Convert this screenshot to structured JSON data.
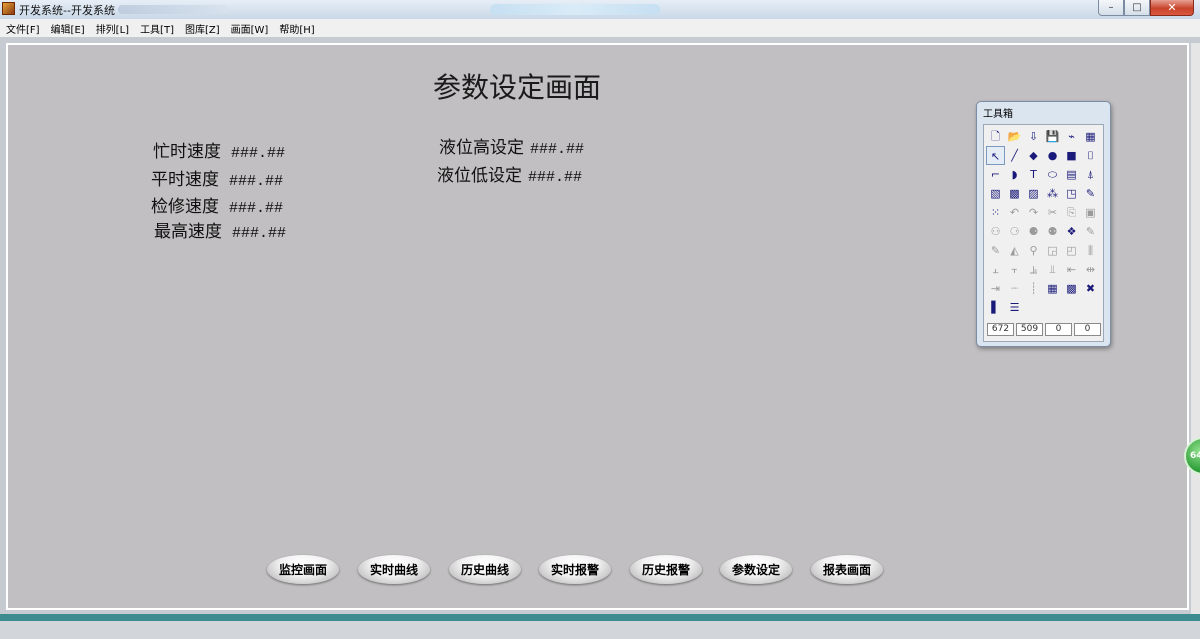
{
  "window": {
    "title": "开发系统--开发系统",
    "buttons": {
      "minimize": "–",
      "maximize": "□",
      "close": "✕"
    }
  },
  "menu": [
    "文件[F]",
    "编辑[E]",
    "排列[L]",
    "工具[T]",
    "图库[Z]",
    "画面[W]",
    "帮助[H]"
  ],
  "screen": {
    "title": "参数设定画面",
    "params_left": [
      {
        "label": "忙时速度",
        "value": "###.##"
      },
      {
        "label": "平时速度",
        "value": "###.##"
      },
      {
        "label": "检修速度",
        "value": "###.##"
      },
      {
        "label": "最高速度",
        "value": "###.##"
      }
    ],
    "params_right": [
      {
        "label": "液位高设定",
        "value": "###.##"
      },
      {
        "label": "液位低设定",
        "value": "###.##"
      }
    ],
    "nav_buttons": [
      "监控画面",
      "实时曲线",
      "历史曲线",
      "实时报警",
      "历史报警",
      "参数设定",
      "报表画面"
    ]
  },
  "toolbox": {
    "title": "工具箱",
    "tools": [
      {
        "glyph": "🗋",
        "name": "new-icon"
      },
      {
        "glyph": "📂",
        "name": "open-icon"
      },
      {
        "glyph": "⇩",
        "name": "import-icon"
      },
      {
        "glyph": "💾",
        "name": "save-icon",
        "dim": true
      },
      {
        "glyph": "⌁",
        "name": "chart-icon"
      },
      {
        "glyph": "▦",
        "name": "picture-icon"
      },
      {
        "glyph": "↖",
        "name": "pointer-icon",
        "sel": true
      },
      {
        "glyph": "╱",
        "name": "line-icon"
      },
      {
        "glyph": "◆",
        "name": "polygon-icon"
      },
      {
        "glyph": "●",
        "name": "ellipse-icon"
      },
      {
        "glyph": "■",
        "name": "rectangle-icon"
      },
      {
        "glyph": "⌷",
        "name": "pipe-icon"
      },
      {
        "glyph": "⌐",
        "name": "polyline-icon"
      },
      {
        "glyph": "◗",
        "name": "arc-icon"
      },
      {
        "glyph": "T",
        "name": "text-icon"
      },
      {
        "glyph": "⬭",
        "name": "rounded-rect-icon"
      },
      {
        "glyph": "▤",
        "name": "button-icon"
      },
      {
        "glyph": "⍋",
        "name": "symbol-icon"
      },
      {
        "glyph": "▧",
        "name": "trend-icon"
      },
      {
        "glyph": "▩",
        "name": "alarm-window-icon"
      },
      {
        "glyph": "▨",
        "name": "report-icon"
      },
      {
        "glyph": "⁂",
        "name": "control-icon"
      },
      {
        "glyph": "◳",
        "name": "gauge-icon"
      },
      {
        "glyph": "✎",
        "name": "edit-icon"
      },
      {
        "glyph": "⁙",
        "name": "menu-icon"
      },
      {
        "glyph": "↶",
        "name": "undo-icon",
        "dim": true
      },
      {
        "glyph": "↷",
        "name": "redo-icon",
        "dim": true
      },
      {
        "glyph": "✂",
        "name": "cut-icon",
        "dim": true
      },
      {
        "glyph": "⎘",
        "name": "copy-icon",
        "dim": true
      },
      {
        "glyph": "▣",
        "name": "paste-icon",
        "dim": true
      },
      {
        "glyph": "⚇",
        "name": "group-icon",
        "dim": true
      },
      {
        "glyph": "⚆",
        "name": "ungroup-icon",
        "dim": true
      },
      {
        "glyph": "⚈",
        "name": "combine-icon",
        "dim": true
      },
      {
        "glyph": "⚉",
        "name": "split-icon",
        "dim": true
      },
      {
        "glyph": "❖",
        "name": "merge-icon"
      },
      {
        "glyph": "✎",
        "name": "reshape-icon",
        "dim": true
      },
      {
        "glyph": "✎",
        "name": "rotate-icon",
        "dim": true
      },
      {
        "glyph": "◭",
        "name": "flip-icon",
        "dim": true
      },
      {
        "glyph": "⚲",
        "name": "mirror-icon",
        "dim": true
      },
      {
        "glyph": "◲",
        "name": "front-icon",
        "dim": true
      },
      {
        "glyph": "◰",
        "name": "back-icon",
        "dim": true
      },
      {
        "glyph": "⫼",
        "name": "align-left-icon",
        "dim": true
      },
      {
        "glyph": "⫠",
        "name": "align-top-icon",
        "dim": true
      },
      {
        "glyph": "⫟",
        "name": "align-middle-icon",
        "dim": true
      },
      {
        "glyph": "⫡",
        "name": "align-bottom-icon",
        "dim": true
      },
      {
        "glyph": "⫫",
        "name": "align-base-icon",
        "dim": true
      },
      {
        "glyph": "⇤",
        "name": "distribute-h-icon",
        "dim": true
      },
      {
        "glyph": "⇹",
        "name": "distribute-v-icon",
        "dim": true
      },
      {
        "glyph": "⇥",
        "name": "align-right-icon",
        "dim": true
      },
      {
        "glyph": "┈",
        "name": "dotted-line-icon",
        "dim": true
      },
      {
        "glyph": "┊",
        "name": "vertical-dots-icon",
        "dim": true
      },
      {
        "glyph": "▦",
        "name": "grid-icon"
      },
      {
        "glyph": "▩",
        "name": "palette-icon"
      },
      {
        "glyph": "✖",
        "name": "color-mix-icon"
      },
      {
        "glyph": "▌",
        "name": "fill-color-icon"
      },
      {
        "glyph": "☰",
        "name": "line-style-icon"
      }
    ],
    "coords": [
      "672",
      "509",
      "0",
      "0"
    ]
  },
  "colors": {
    "canvas": "#c1bfc1",
    "accent_strip": "#3c8b8e"
  }
}
